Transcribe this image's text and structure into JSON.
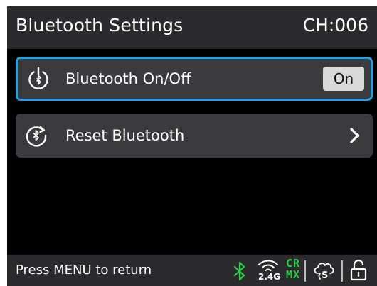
{
  "header": {
    "title": "Bluetooth Settings",
    "channel": "CH:006"
  },
  "menu": [
    {
      "label": "Bluetooth On/Off",
      "value": "On",
      "icon": "bluetooth-power-icon",
      "selected": true
    },
    {
      "label": "Reset Bluetooth",
      "icon": "bluetooth-reset-icon",
      "selected": false
    }
  ],
  "footer": {
    "hint": "Press MENU to return",
    "status_icons": [
      "bluetooth-icon",
      "wifi-2.4g-icon",
      "crmx-icon",
      "cloud-icon",
      "unlock-icon"
    ],
    "wifi_band_label": "2.4G",
    "crmx_top": "CR",
    "crmx_bottom": "MX",
    "cloud_label": "S"
  },
  "colors": {
    "selection_border": "#1ea4e6",
    "status_green": "#2ecc4a",
    "panel": "#2b2b2d",
    "row": "#3b3b3d"
  }
}
